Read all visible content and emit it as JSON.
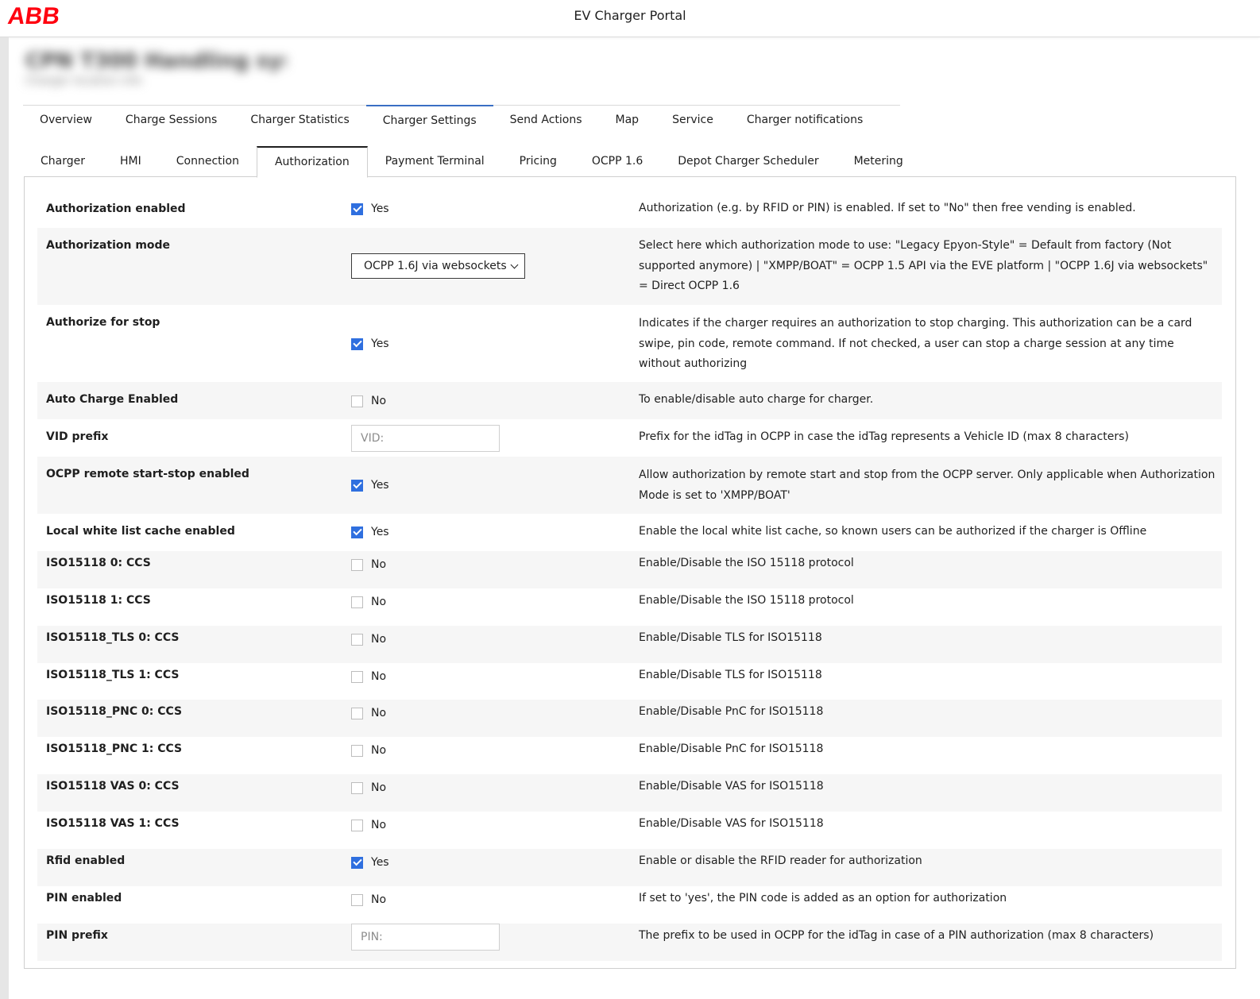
{
  "header": {
    "logo": "ABB",
    "title": "EV Charger Portal"
  },
  "charger_header": {
    "name": "CPN T300 Handling sys",
    "subtitle": "Charger location info"
  },
  "main_tabs": [
    {
      "label": "Overview"
    },
    {
      "label": "Charge Sessions"
    },
    {
      "label": "Charger Statistics"
    },
    {
      "label": "Charger Settings"
    },
    {
      "label": "Send Actions"
    },
    {
      "label": "Map"
    },
    {
      "label": "Service"
    },
    {
      "label": "Charger notifications"
    }
  ],
  "settings_tabs": [
    {
      "label": "Charger"
    },
    {
      "label": "HMI"
    },
    {
      "label": "Connection"
    },
    {
      "label": "Authorization"
    },
    {
      "label": "Payment Terminal"
    },
    {
      "label": "Pricing"
    },
    {
      "label": "OCPP 1.6"
    },
    {
      "label": "Depot Charger Scheduler"
    },
    {
      "label": "Metering"
    }
  ],
  "settings": [
    {
      "label": "Authorization enabled",
      "value": "Yes",
      "description": "Authorization (e.g. by RFID or PIN) is enabled. If set to \"No\" then free vending is enabled."
    },
    {
      "label": "Authorization mode",
      "value": "OCPP 1.6J via websockets",
      "description": "Select here which authorization mode to use: \"Legacy Epyon-Style\" = Default from factory (Not supported anymore) | \"XMPP/BOAT\" = OCPP 1.5 API via the EVE platform | \"OCPP 1.6J via websockets\" = Direct OCPP 1.6"
    },
    {
      "label": "Authorize for stop",
      "value": "Yes",
      "description": "Indicates if the charger requires an authorization to stop charging. This authorization can be a card swipe, pin code, remote command. If not checked, a user can stop a charge session at any time without authorizing"
    },
    {
      "label": "Auto Charge Enabled",
      "value": "No",
      "description": "To enable/disable auto charge for charger."
    },
    {
      "label": "VID prefix",
      "placeholder": "VID:",
      "description": "Prefix for the idTag in OCPP in case the idTag represents a Vehicle ID (max 8 characters)"
    },
    {
      "label": "OCPP remote start-stop enabled",
      "value": "Yes",
      "description": "Allow authorization by remote start and stop from the OCPP server. Only applicable when Authorization Mode is set to 'XMPP/BOAT'"
    },
    {
      "label": "Local white list cache enabled",
      "value": "Yes",
      "description": "Enable the local white list cache, so known users can be authorized if the charger is Offline"
    },
    {
      "label": "ISO15118 0: CCS",
      "value": "No",
      "description": "Enable/Disable the ISO 15118 protocol"
    },
    {
      "label": "ISO15118 1: CCS",
      "value": "No",
      "description": "Enable/Disable the ISO 15118 protocol"
    },
    {
      "label": "ISO15118_TLS 0: CCS",
      "value": "No",
      "description": "Enable/Disable TLS for ISO15118"
    },
    {
      "label": "ISO15118_TLS 1: CCS",
      "value": "No",
      "description": "Enable/Disable TLS for ISO15118"
    },
    {
      "label": "ISO15118_PNC 0: CCS",
      "value": "No",
      "description": "Enable/Disable PnC for ISO15118"
    },
    {
      "label": "ISO15118_PNC 1: CCS",
      "value": "No",
      "description": "Enable/Disable PnC for ISO15118"
    },
    {
      "label": "ISO15118 VAS 0: CCS",
      "value": "No",
      "description": "Enable/Disable VAS for ISO15118"
    },
    {
      "label": "ISO15118 VAS 1: CCS",
      "value": "No",
      "description": "Enable/Disable VAS for ISO15118"
    },
    {
      "label": "Rfid enabled",
      "value": "Yes",
      "description": "Enable or disable the RFID reader for authorization"
    },
    {
      "label": "PIN enabled",
      "value": "No",
      "description": "If set to 'yes', the PIN code is added as an option for authorization"
    },
    {
      "label": "PIN prefix",
      "placeholder": "PIN:",
      "description": "The prefix to be used in OCPP for the idTag in case of a PIN authorization (max 8 characters)"
    }
  ]
}
